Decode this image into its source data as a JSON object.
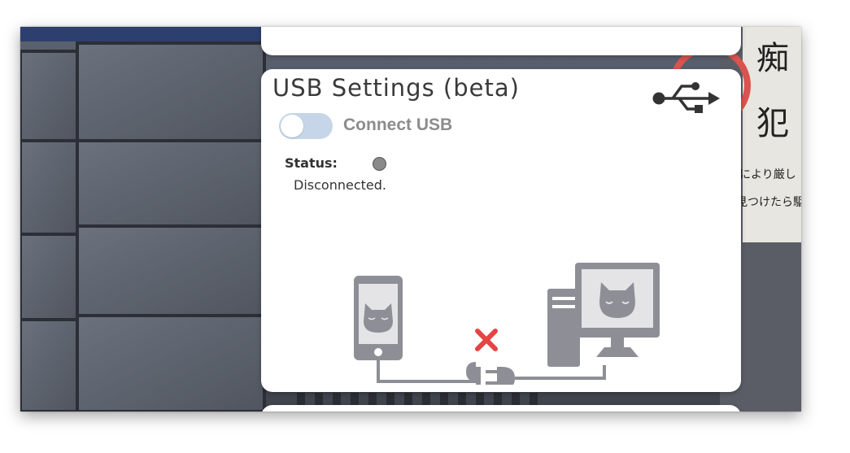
{
  "usb_settings": {
    "title": "USB Settings (beta)",
    "toggle_label": "Connect USB",
    "toggle_on": false,
    "status_label": "Status:",
    "status_value": "Disconnected.",
    "status_color": "#8a8a8a"
  },
  "background": {
    "sign_text": [
      "痴",
      "犯",
      "により厳し",
      "見つけたら駆"
    ]
  },
  "colors": {
    "accent_off": "#c6d6e8",
    "device_gray": "#8e8f96",
    "error_red": "#e64343"
  },
  "icons": [
    "usb-icon",
    "phone-icon",
    "computer-icon",
    "disconnected-x-icon",
    "plug-icon"
  ]
}
